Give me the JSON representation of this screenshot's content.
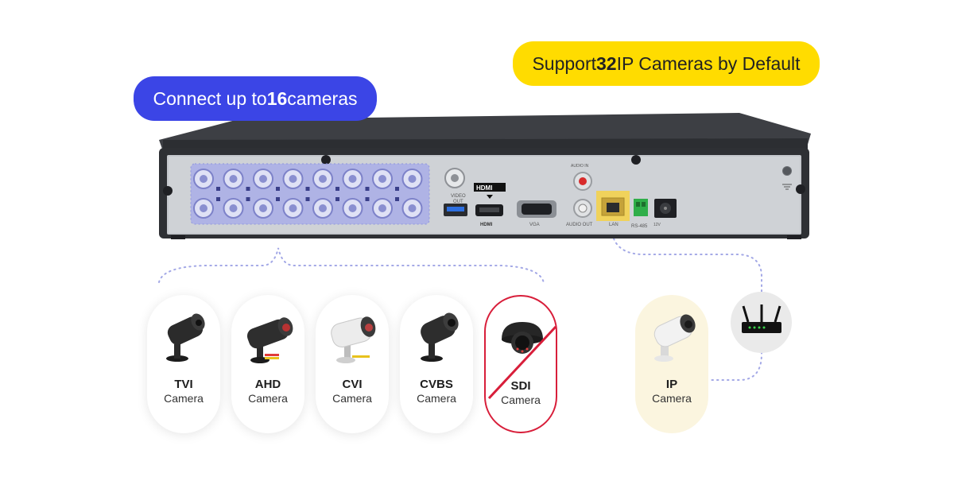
{
  "callouts": {
    "left": {
      "pre": "Connect up to ",
      "bold": "16",
      "post": " cameras",
      "color": "#3b45e6"
    },
    "right": {
      "pre": "Support ",
      "bold": "32",
      "post": " IP Cameras by Default",
      "color": "#ffdc00"
    }
  },
  "dvr_panel": {
    "video_out": "VIDEO\nOUT",
    "video_out_1": "VIDEO",
    "video_out_2": "OUT",
    "hdmi_logo": "HDMI",
    "hdmi_label": "HDMI",
    "vga": "VGA",
    "audio_in": "AUDIO IN",
    "audio_out": "AUDIO OUT",
    "lan": "LAN",
    "rs485": "RS-485",
    "power": "12V"
  },
  "cameras": [
    {
      "type": "TVI",
      "label": "Camera",
      "icon": "bullet-camera-icon",
      "supported": true
    },
    {
      "type": "AHD",
      "label": "Camera",
      "icon": "bullet-camera-icon",
      "supported": true
    },
    {
      "type": "CVI",
      "label": "Camera",
      "icon": "bullet-camera-icon",
      "supported": true
    },
    {
      "type": "CVBS",
      "label": "Camera",
      "icon": "bullet-camera-icon",
      "supported": true
    },
    {
      "type": "SDI",
      "label": "Camera",
      "icon": "dome-camera-icon",
      "supported": false
    }
  ],
  "ip_camera": {
    "type": "IP",
    "label": "Camera",
    "icon": "ip-bullet-camera-icon"
  },
  "router": {
    "icon": "router-icon"
  },
  "colors": {
    "highlight": "#a9aee8",
    "sdi_cross": "#d81e3a",
    "ip_card": "#fbf5df",
    "connector_dots": "#9aa0e0"
  }
}
